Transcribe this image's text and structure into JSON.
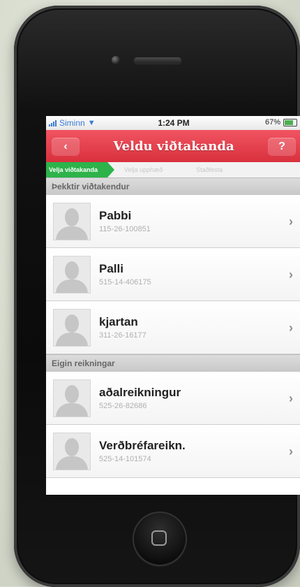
{
  "status": {
    "carrier": "Siminn",
    "time": "1:24 PM",
    "battery": "67%"
  },
  "nav": {
    "back": "‹",
    "title": "Veldu viðtakanda",
    "help": "?"
  },
  "steps": [
    "Velja viðtakanda",
    "Velja upphæð",
    "Staðfesta"
  ],
  "sections": [
    {
      "label": "Þekktir viðtakendur",
      "rows": [
        {
          "name": "Pabbi",
          "account": "115-26-100851"
        },
        {
          "name": "Palli",
          "account": "515-14-406175"
        },
        {
          "name": "kjartan",
          "account": "311-26-16177"
        }
      ]
    },
    {
      "label": "Eigin reikningar",
      "rows": [
        {
          "name": "aðalreikningur",
          "account": "525-26-82686"
        },
        {
          "name": "Verðbréfareikn.",
          "account": "525-14-101574"
        }
      ]
    }
  ],
  "chevron": "›"
}
